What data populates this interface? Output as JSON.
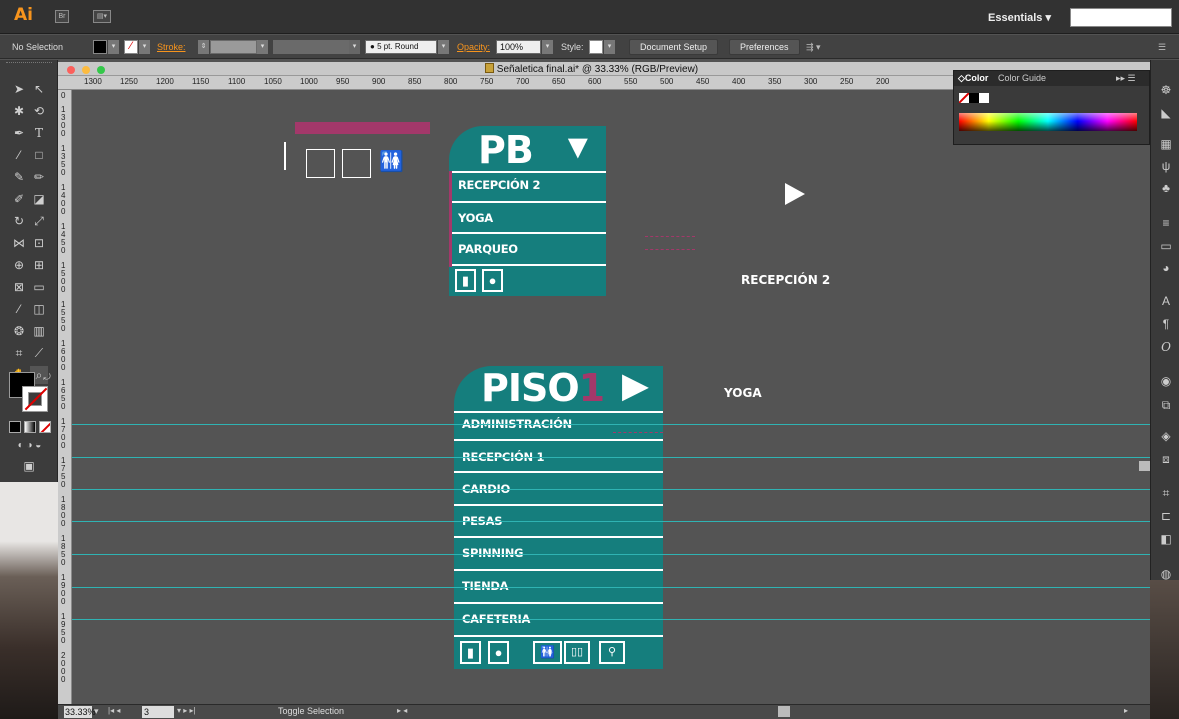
{
  "app": {
    "logo": "Ai",
    "workspace": "Essentials",
    "workspace_caret": "▾",
    "search_value": ""
  },
  "control_bar": {
    "selection": "No Selection",
    "stroke_label": "Stroke:",
    "brush": "5 pt. Round",
    "opacity_label": "Opacity:",
    "opacity_value": "100%",
    "style_label": "Style:",
    "document_setup": "Document Setup",
    "preferences": "Preferences"
  },
  "document": {
    "title": "Señaletica final.ai* @ 33.33% (RGB/Preview)"
  },
  "ruler_top": [
    "1300",
    "1250",
    "1200",
    "1150",
    "1100",
    "1050",
    "1000",
    "950",
    "900",
    "850",
    "800",
    "750",
    "700",
    "650",
    "600",
    "550",
    "500",
    "450",
    "400",
    "350",
    "300",
    "250",
    "200"
  ],
  "ruler_left": [
    "0",
    "1300",
    "1350",
    "1400",
    "1450",
    "1500",
    "1550",
    "1600",
    "1650",
    "1700",
    "1750",
    "1800",
    "1850",
    "1900",
    "1950",
    "2000"
  ],
  "color_panel": {
    "tab_color": "Color",
    "tab_guide": "Color Guide"
  },
  "signs": {
    "pb": {
      "title": "PB",
      "arrow": "▼",
      "items": [
        "RECEPCIÓN 2",
        "YOGA",
        "PARQUEO"
      ],
      "icons": [
        "extinguisher-icon",
        "water-drop-icon"
      ]
    },
    "piso1": {
      "title": "PISO",
      "number": "1",
      "arrow": "▶",
      "items": [
        "ADMINISTRACIÓN",
        "RECEPCIÓN 1",
        "CARDIO",
        "PESAS",
        "SPINNING",
        "TIENDA",
        "CAFETERIA"
      ],
      "icons": [
        "extinguisher-icon",
        "water-drop-icon",
        "restroom-icon",
        "elevator-icon",
        "family-restroom-icon"
      ]
    }
  },
  "loose_text": {
    "recepcion": "RECEPCIÓN 2",
    "yoga": "YOGA"
  },
  "status_bar": {
    "zoom": "33.33%",
    "artboard": "3",
    "status": "Toggle Selection"
  },
  "colors": {
    "sign_teal": "#157e7d",
    "magenta": "#a3386a",
    "guide_cyan": "#2fb3b3",
    "ai_orange": "#f7941d"
  }
}
